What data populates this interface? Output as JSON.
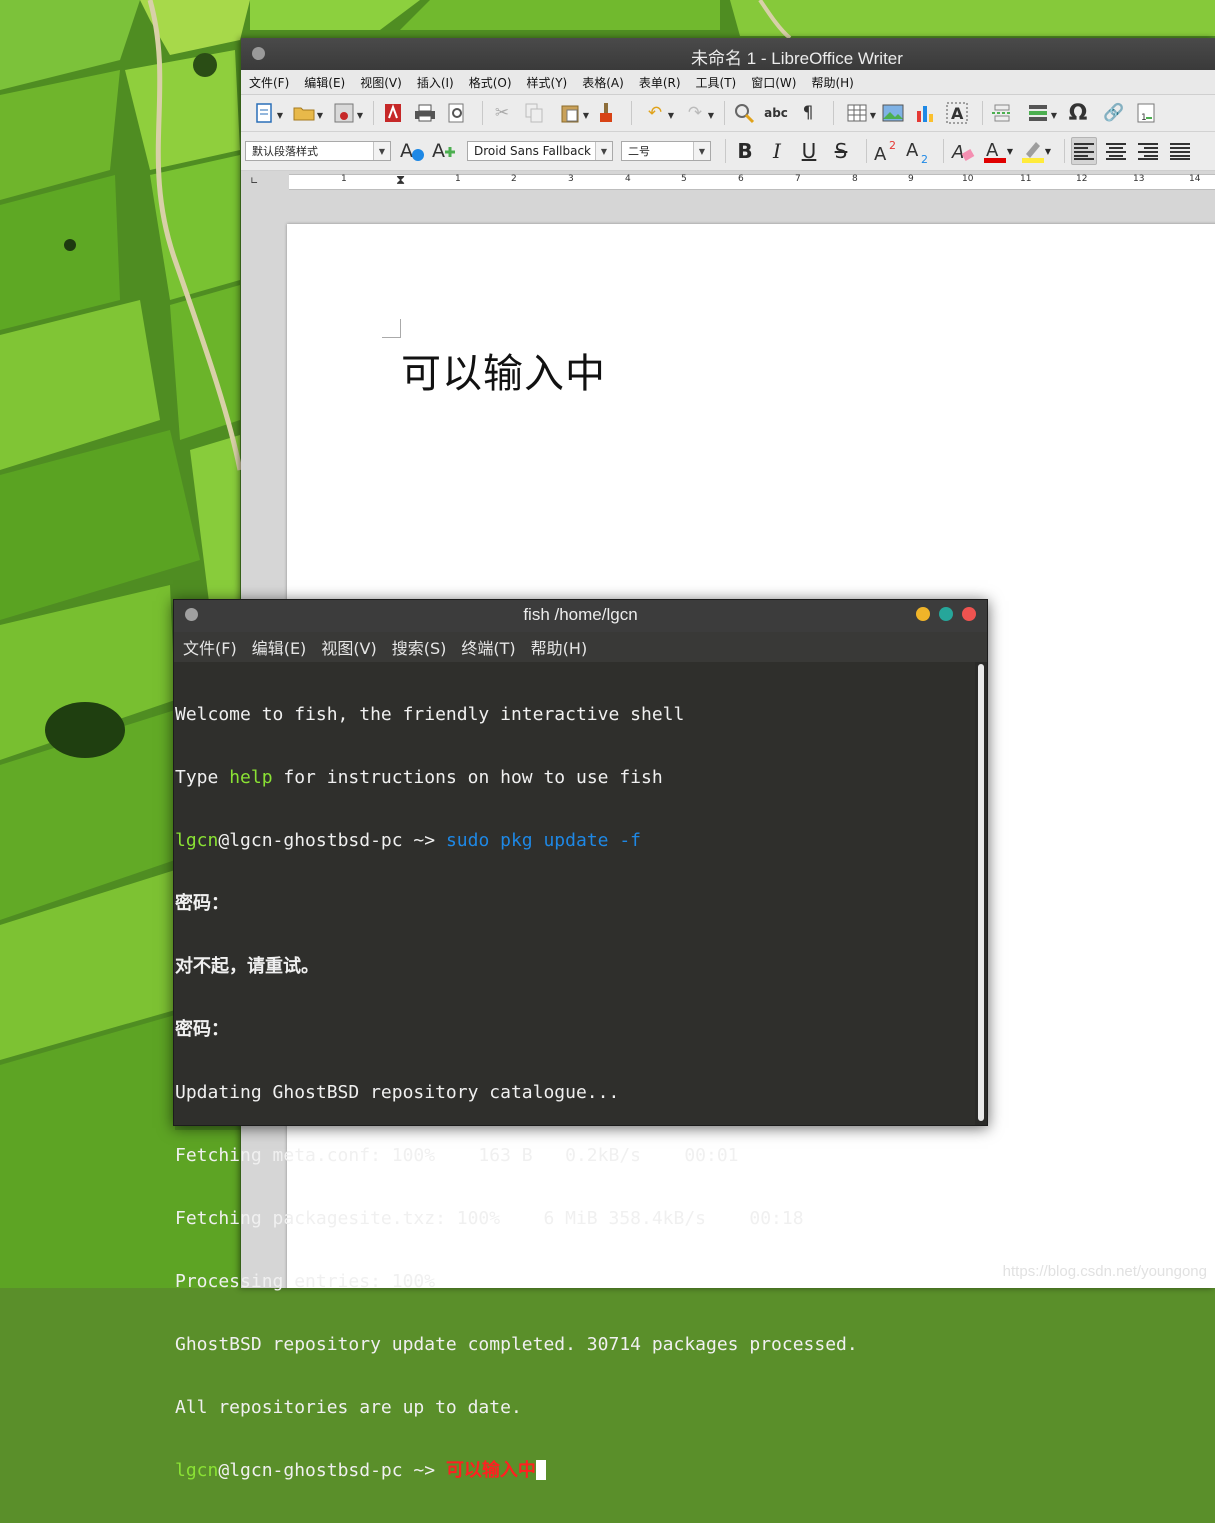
{
  "libreoffice": {
    "title": "未命名 1 - LibreOffice Writer",
    "menus": [
      "文件(F)",
      "编辑(E)",
      "视图(V)",
      "插入(I)",
      "格式(O)",
      "样式(Y)",
      "表格(A)",
      "表单(R)",
      "工具(T)",
      "窗口(W)",
      "帮助(H)"
    ],
    "paragraph_style": "默认段落样式",
    "font_name": "Droid Sans Fallback",
    "font_size": "二号",
    "ruler_numbers": [
      "1",
      "1",
      "2",
      "3",
      "4",
      "5",
      "6",
      "7",
      "8",
      "9",
      "10",
      "11",
      "12",
      "13",
      "14"
    ],
    "document_text": "可以输入中",
    "icons": {
      "bold": "B",
      "italic": "I",
      "underline": "U",
      "strike": "S",
      "omega": "Ω",
      "pilcrow": "¶"
    }
  },
  "terminal": {
    "title": "fish /home/lgcn",
    "menus": [
      "文件(F)",
      "编辑(E)",
      "视图(V)",
      "搜索(S)",
      "终端(T)",
      "帮助(H)"
    ],
    "lines": {
      "l1": "Welcome to fish, the friendly interactive shell",
      "l2a": "Type ",
      "l2b": "help",
      "l2c": " for instructions on how to use fish",
      "prompt_user": "lgcn",
      "prompt_host": "@lgcn-ghostbsd-pc ~> ",
      "cmd1": "sudo pkg update -f",
      "l4": "密码：",
      "l5": "对不起，请重试。",
      "l6": "密码：",
      "l7": "Updating GhostBSD repository catalogue...",
      "l8": "Fetching meta.conf: 100%    163 B   0.2kB/s    00:01",
      "l9": "Fetching packagesite.txz: 100%    6 MiB 358.4kB/s    00:18",
      "l10": "Processing entries: 100%",
      "l11": "GhostBSD repository update completed. 30714 packages processed.",
      "l12": "All repositories are up to date.",
      "cmd2": "可以输入中"
    },
    "colors": {
      "green": "#8ae234",
      "blue": "#1e88e5",
      "red": "#ff2020"
    }
  },
  "watermark": "https://blog.csdn.net/youngong"
}
